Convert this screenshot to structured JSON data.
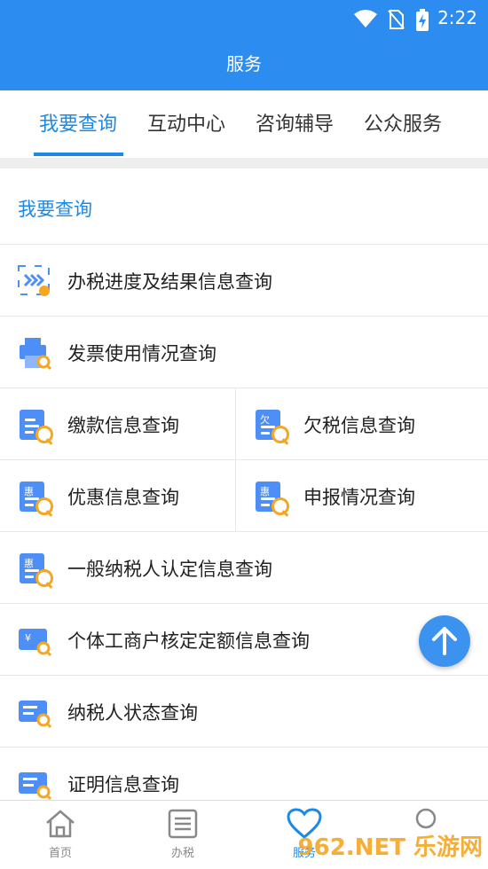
{
  "status": {
    "time": "2:22"
  },
  "title": "服务",
  "tabs": [
    "我要查询",
    "互动中心",
    "咨询辅导",
    "公众服务"
  ],
  "section_title": "我要查询",
  "items": {
    "progress": "办税进度及结果信息查询",
    "invoice": "发票使用情况查询",
    "payment": "缴款信息查询",
    "owed": "欠税信息查询",
    "preferential": "优惠信息查询",
    "declaration": "申报情况查询",
    "general_taxpayer": "一般纳税人认定信息查询",
    "individual_business": "个体工商户核定定额信息查询",
    "taxpayer_status": "纳税人状态查询",
    "certificate": "证明信息查询"
  },
  "icon_tags": {
    "owed": "欠",
    "preferential": "惠",
    "declaration": "惠",
    "general_taxpayer": "惠",
    "individual_business": "¥"
  },
  "bottom_nav": [
    "首页",
    "办税",
    "服务"
  ],
  "watermark": "962.NET 乐游网",
  "colors": {
    "primary": "#2d8cf0",
    "accent": "#1e88e5",
    "icon_blue": "#4e8ef7",
    "icon_orange": "#f5a623"
  }
}
